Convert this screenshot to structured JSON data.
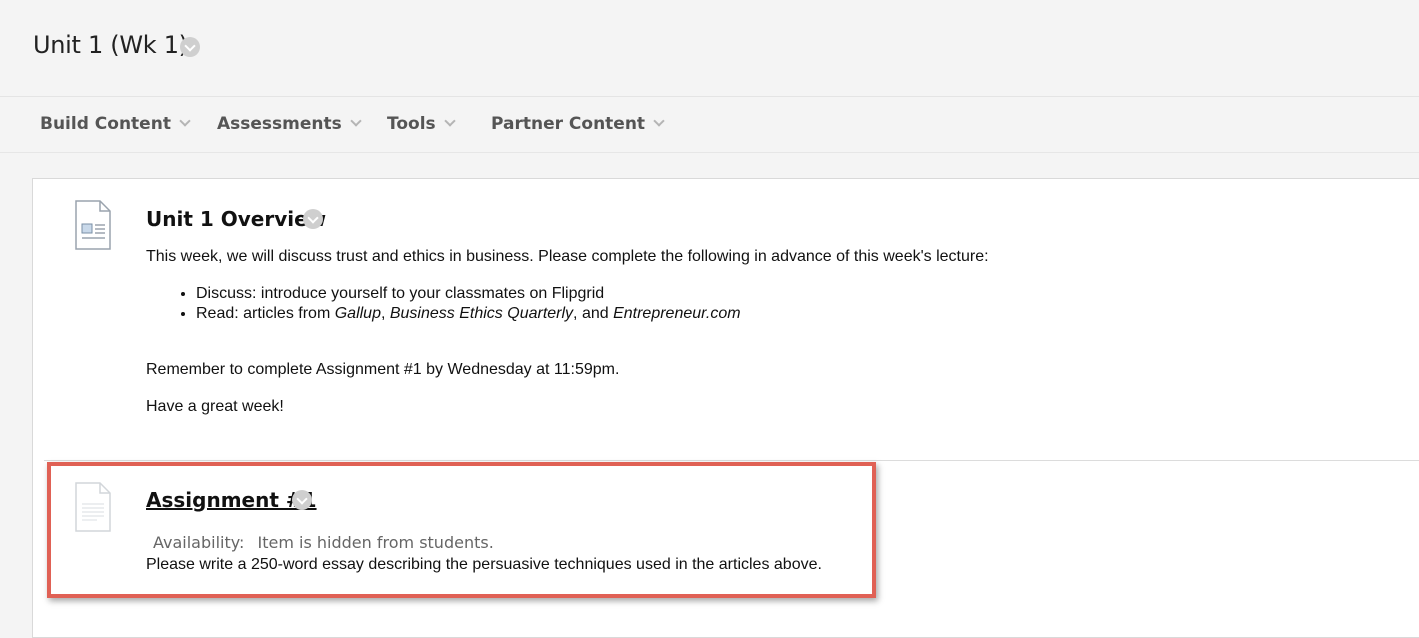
{
  "header": {
    "title": "Unit 1 (Wk 1)"
  },
  "action_bar": {
    "items": [
      {
        "label": "Build Content"
      },
      {
        "label": "Assessments"
      },
      {
        "label": "Tools"
      },
      {
        "label": "Partner Content"
      }
    ]
  },
  "content": {
    "items": [
      {
        "title": "Unit 1 Overview",
        "icon": "document-item-icon",
        "intro": "This week, we will discuss trust and ethics in business. Please complete the following in advance of this week's lecture:",
        "bullets": [
          {
            "text": "Discuss: introduce yourself to your classmates on Flipgrid"
          },
          {
            "prefix": "Read: articles from ",
            "italic1": "Gallup",
            "sep1": ", ",
            "italic2": "Business Ethics Quarterly",
            "sep2": ", and ",
            "italic3": "Entrepreneur.com"
          }
        ],
        "reminder": "Remember to complete Assignment #1 by Wednesday at 11:59pm.",
        "closing": "Have a great week!"
      },
      {
        "title": "Assignment #1",
        "icon": "assignment-item-icon",
        "availability_label": "Availability:",
        "availability_value": "Item is hidden from students.",
        "description": "Please write a 250-word essay describing the persuasive techniques used in the articles above."
      }
    ]
  },
  "colors": {
    "highlight_border": "#e06155",
    "page_background": "#f4f4f4"
  }
}
